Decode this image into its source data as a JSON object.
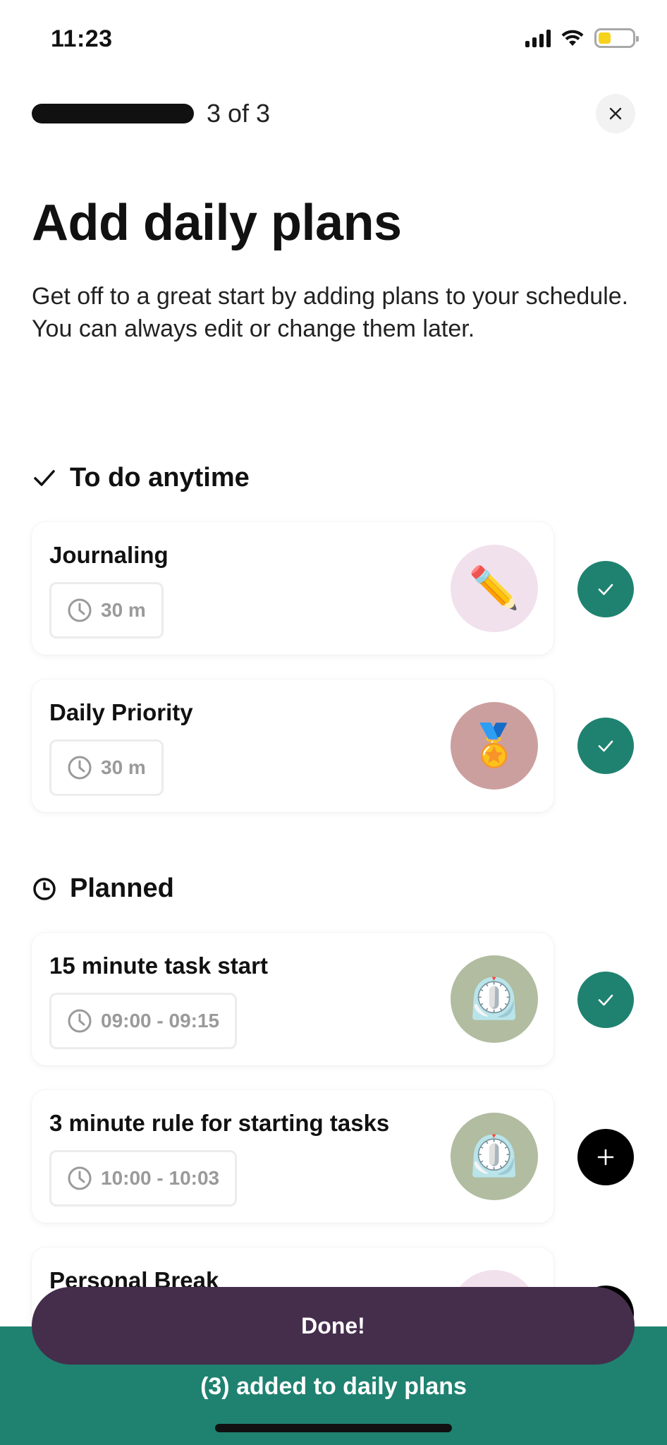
{
  "status_bar": {
    "time": "11:23"
  },
  "header": {
    "progress_text": "3 of 3",
    "close_icon": "close-icon"
  },
  "page": {
    "title": "Add daily plans",
    "description": "Get off to a great start by adding plans to your schedule. You can always edit or change them later."
  },
  "sections": {
    "anytime": {
      "title": "To do anytime",
      "icon": "check-icon"
    },
    "planned": {
      "title": "Planned",
      "icon": "clock-icon"
    }
  },
  "plans": [
    {
      "title": "Journaling",
      "duration": "30 m",
      "emoji": "✏️",
      "emoji_bg": "#f1e1ed",
      "state": "added"
    },
    {
      "title": "Daily Priority",
      "duration": "30 m",
      "emoji": "🏅",
      "emoji_bg": "#cc9f9f",
      "state": "added"
    },
    {
      "title": "15 minute task start",
      "duration": "09:00 - 09:15",
      "emoji": "⏲️",
      "emoji_bg": "#b1bca0",
      "state": "added"
    },
    {
      "title": "3 minute rule for starting tasks",
      "duration": "10:00 - 10:03",
      "emoji": "⏲️",
      "emoji_bg": "#b1bca0",
      "state": "add"
    },
    {
      "title": "Personal Break",
      "emoji_bg": "#f1e1ed",
      "state": "add"
    }
  ],
  "footer": {
    "done_label": "Done!",
    "added_text": "(3) added to daily plans"
  },
  "colors": {
    "accent_teal": "#1f8270",
    "done_purple": "#452d4c",
    "add_black": "#000000"
  }
}
